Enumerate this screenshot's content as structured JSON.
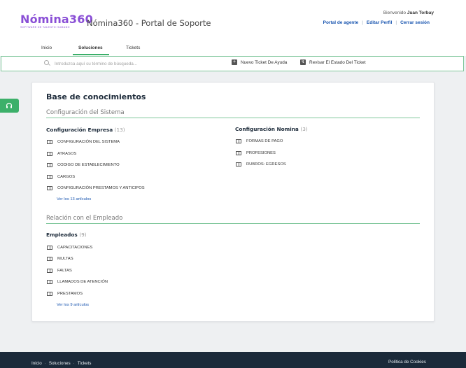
{
  "logo": {
    "name": "Nómina360",
    "tagline": "SOFTWARE DE TALENTO HUMANO"
  },
  "header": {
    "title": "Nómina360 - Portal de Soporte",
    "welcome_prefix": "Bienvenido",
    "user_name": "Juan Torbay",
    "links": [
      "Portal de agente",
      "Editar Perfil",
      "Cerrar sesión"
    ]
  },
  "nav": {
    "items": [
      "Inicio",
      "Soluciones",
      "Tickets"
    ],
    "active": "Soluciones"
  },
  "search": {
    "placeholder": "Introduzca aquí su término de búsqueda...",
    "actions": [
      "Nuevo Ticket De Ayuda",
      "Revisar El Estado Del Ticket"
    ]
  },
  "kb": {
    "title": "Base de conocimientos",
    "sections": [
      {
        "title": "Configuración del Sistema",
        "categories": [
          {
            "name": "Configuración Empresa",
            "count": "(13)",
            "articles": [
              "CONFIGURACIÓN DEL SISTEMA",
              "ATRASOS",
              "CODIGO DE ESTABLECIMIENTO",
              "CARGOS",
              "CONFIGURACIÓN PRESTAMOS Y ANTICIPOS"
            ],
            "more": "Ver los 13 artículos"
          },
          {
            "name": "Configuración Nomina",
            "count": "(3)",
            "articles": [
              "FORMAS DE PAGO",
              "PROFESIONES",
              "RUBROS: EGRESOS"
            ]
          }
        ]
      },
      {
        "title": "Relación con el Empleado",
        "categories": [
          {
            "name": "Empleados",
            "count": "(9)",
            "articles": [
              "CAPACITACIONES",
              "MULTAS",
              "FALTAS",
              "LLAMADOS DE ATENCIÓN",
              "PRESTAMOS"
            ],
            "more": "Ver los 9 artículos"
          }
        ]
      }
    ]
  },
  "footer": {
    "links": [
      "Inicio",
      "Soluciones",
      "Tickets"
    ],
    "cookies": "Política de Cookies"
  },
  "colors": {
    "brand": "#8a4fd6",
    "accent": "#3cb06a",
    "link": "#1a56b0",
    "footer": "#1b2a3a"
  },
  "icons": {
    "help": "headset-icon",
    "search": "search-icon",
    "new_ticket": "plus-icon",
    "status": "chart-icon",
    "article": "book-icon"
  }
}
